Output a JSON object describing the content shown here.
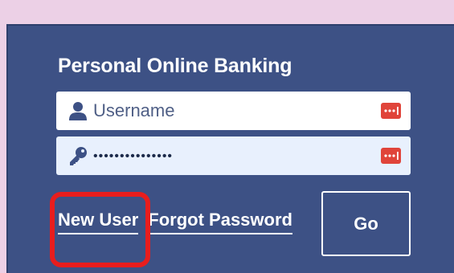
{
  "login": {
    "title": "Personal Online Banking",
    "username": {
      "placeholder": "Username",
      "value": "",
      "icon": "user-icon"
    },
    "password": {
      "value": "•••••••••••••••",
      "icon": "key-icon"
    },
    "password_manager_icon": "password-manager-icon",
    "links": {
      "new_user": "New User",
      "forgot_password": "Forgot Password"
    },
    "go_label": "Go"
  },
  "colors": {
    "page_background": "#ecd0e6",
    "panel_background": "#3d5185",
    "password_field_background": "#e8f0fd",
    "highlight": "#e81d1d",
    "password_manager_icon": "#e0443a"
  }
}
